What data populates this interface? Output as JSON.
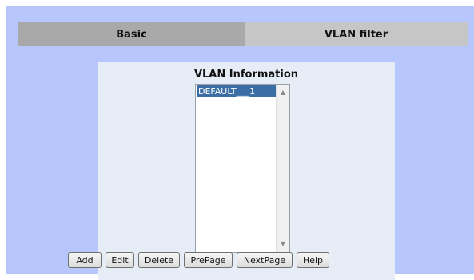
{
  "tabs": {
    "basic": "Basic",
    "vlan_filter": "VLAN filter"
  },
  "panel": {
    "title": "VLAN Information",
    "list_items": [
      "DEFAULT___1"
    ]
  },
  "buttons": {
    "add": "Add",
    "edit": "Edit",
    "delete": "Delete",
    "prepage": "PrePage",
    "nextpage": "NextPage",
    "help": "Help"
  },
  "colors": {
    "frame_bg": "#b7c7fd",
    "tab_basic_bg": "#a9a9a9",
    "tab_vlan_bg": "#c6c6c6",
    "panel_bg": "#e7edf7",
    "selected_item_bg": "#3a6ea5"
  },
  "icons": {
    "scroll_up": "up-arrow-icon",
    "scroll_down": "down-arrow-icon"
  }
}
